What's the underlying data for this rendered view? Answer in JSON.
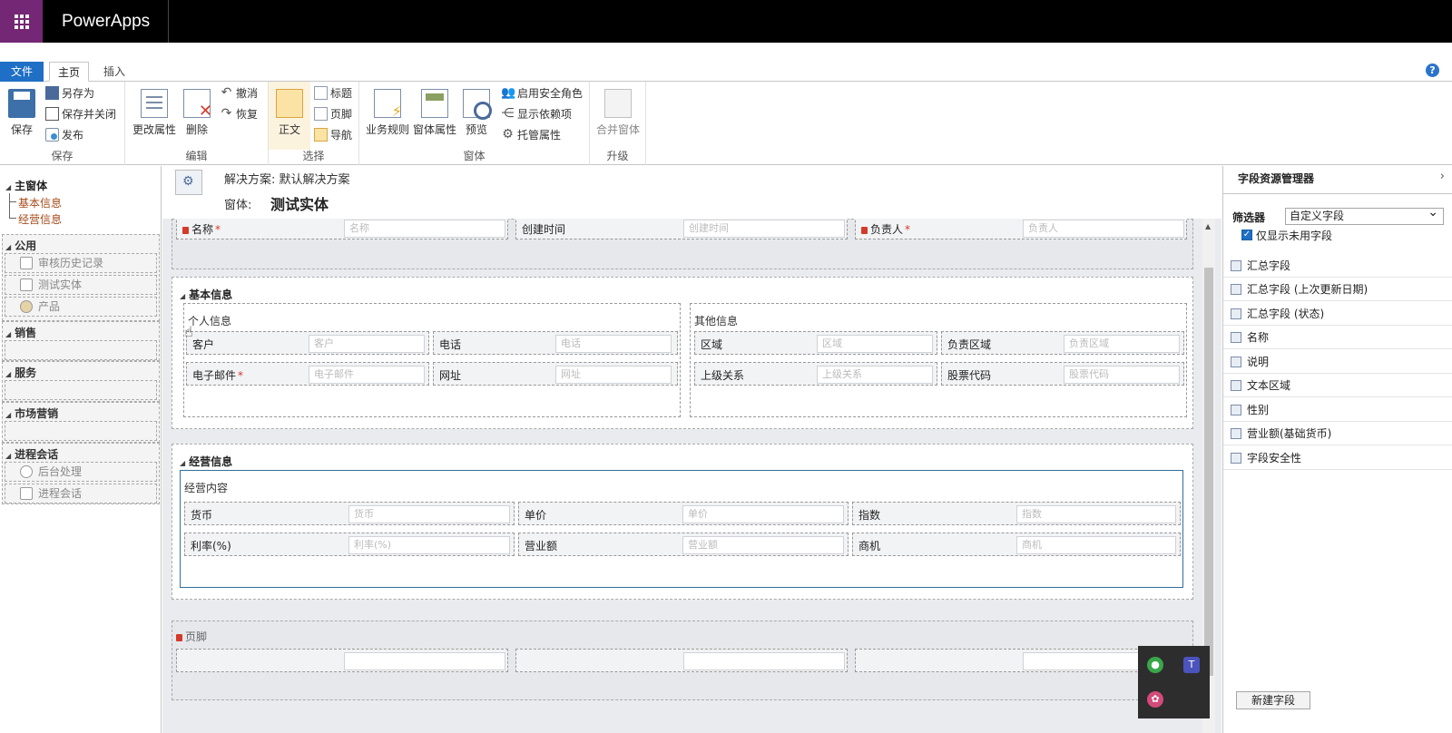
{
  "app": {
    "name": "PowerApps",
    "help": "?"
  },
  "tabs": {
    "file": "文件",
    "home": "主页",
    "insert": "插入"
  },
  "ribbon": {
    "save": {
      "save": "保存",
      "save_as": "另存为",
      "save_close": "保存并关闭",
      "publish": "发布",
      "group": "保存"
    },
    "edit": {
      "change_props": "更改属性",
      "delete": "删除",
      "undo": "撤消",
      "redo": "恢复",
      "group": "编辑"
    },
    "select": {
      "body": "正文",
      "header": "标题",
      "footer": "页脚",
      "nav": "导航",
      "group": "选择"
    },
    "form": {
      "business_rules": "业务规则",
      "form_props": "窗体属性",
      "preview": "预览",
      "security_roles": "启用安全角色",
      "show_deps": "显示依赖项",
      "managed_props": "托管属性",
      "group": "窗体"
    },
    "upgrade": {
      "merge": "合并窗体",
      "group": "升级"
    }
  },
  "nav": {
    "main": "主窗体",
    "links": [
      "基本信息",
      "经营信息"
    ],
    "sections": [
      {
        "title": "公用",
        "items": [
          "审核历史记录",
          "测试实体",
          "产品"
        ]
      },
      {
        "title": "销售",
        "items": []
      },
      {
        "title": "服务",
        "items": []
      },
      {
        "title": "市场营销",
        "items": []
      },
      {
        "title": "进程会话",
        "items": [
          "后台处理",
          "进程会话"
        ]
      }
    ]
  },
  "header": {
    "solution": "解决方案: 默认解决方案",
    "form_label": "窗体:",
    "entity": "测试实体"
  },
  "header_fields": [
    {
      "label": "名称",
      "placeholder": "名称",
      "required": true
    },
    {
      "label": "创建时间",
      "placeholder": "创建时间",
      "required": false
    },
    {
      "label": "负责人",
      "placeholder": "负责人",
      "required": true
    }
  ],
  "tab_basic": {
    "title": "基本信息",
    "personal": {
      "title": "个人信息",
      "fields": [
        {
          "label": "客户",
          "placeholder": "客户"
        },
        {
          "label": "电话",
          "placeholder": "电话"
        },
        {
          "label": "电子邮件",
          "placeholder": "电子邮件",
          "required": true
        },
        {
          "label": "网址",
          "placeholder": "网址"
        }
      ]
    },
    "other": {
      "title": "其他信息",
      "fields": [
        {
          "label": "区域",
          "placeholder": "区域"
        },
        {
          "label": "负责区域",
          "placeholder": "负责区域"
        },
        {
          "label": "上级关系",
          "placeholder": "上级关系"
        },
        {
          "label": "股票代码",
          "placeholder": "股票代码"
        }
      ]
    }
  },
  "tab_business": {
    "title": "经营信息",
    "section": {
      "title": "经营内容",
      "fields": [
        {
          "label": "货币",
          "placeholder": "货币"
        },
        {
          "label": "单价",
          "placeholder": "单价"
        },
        {
          "label": "指数",
          "placeholder": "指数"
        },
        {
          "label": "利率(%)",
          "placeholder": "利率(%)"
        },
        {
          "label": "营业额",
          "placeholder": "营业额"
        },
        {
          "label": "商机",
          "placeholder": "商机"
        }
      ]
    }
  },
  "footer": {
    "label": "页脚"
  },
  "field_explorer": {
    "title": "字段资源管理器",
    "filter_label": "筛选器",
    "filter_value": "自定义字段",
    "only_unused": "仅显示未用字段",
    "fields": [
      "汇总字段",
      "汇总字段 (上次更新日期)",
      "汇总字段 (状态)",
      "名称",
      "说明",
      "文本区域",
      "性别",
      "营业额(基础货币)",
      "字段安全性"
    ],
    "new_field": "新建字段"
  },
  "colors": {
    "accent": "#1e6fc5",
    "waffle": "#742774",
    "nav_link": "#a64b1a",
    "required": "#d43a2a"
  }
}
